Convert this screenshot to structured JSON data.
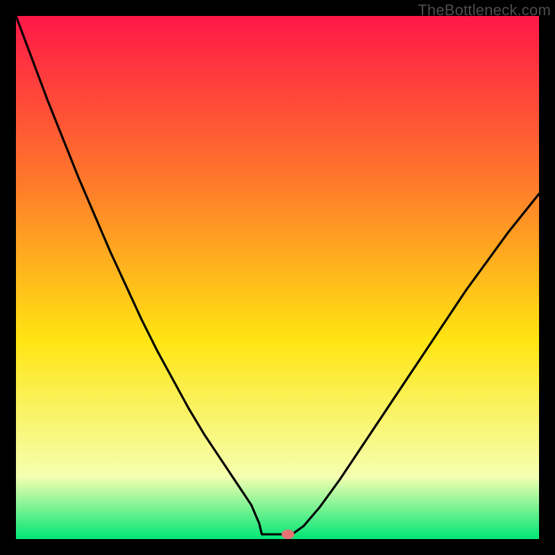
{
  "watermark": "TheBottleneck.com",
  "chart_data": {
    "type": "line",
    "title": "",
    "xlabel": "",
    "ylabel": "",
    "xlim": [
      0,
      100
    ],
    "ylim": [
      0,
      100
    ],
    "grid": false,
    "series": [
      {
        "name": "bottleneck-curve",
        "color": "#000000",
        "x": [
          0.0,
          3.0,
          6.0,
          9.0,
          12.0,
          15.0,
          18.0,
          21.0,
          24.0,
          27.0,
          30.0,
          33.0,
          36.0,
          39.0,
          42.0,
          45.0,
          46.5,
          47.0,
          51.0,
          52.8,
          55.0,
          58.0,
          62.0,
          66.0,
          70.0,
          74.0,
          78.0,
          82.0,
          86.0,
          90.0,
          94.0,
          98.0,
          100.0
        ],
        "y": [
          100.0,
          92.0,
          84.0,
          76.5,
          69.0,
          62.0,
          55.0,
          48.5,
          42.0,
          36.0,
          30.5,
          25.0,
          20.0,
          15.5,
          11.0,
          6.5,
          3.0,
          0.9,
          0.9,
          0.9,
          2.5,
          6.0,
          11.5,
          17.5,
          23.5,
          29.5,
          35.5,
          41.5,
          47.5,
          53.0,
          58.5,
          63.5,
          66.0
        ]
      }
    ],
    "marker": {
      "name": "sweet-spot",
      "x": 52.0,
      "y": 0.9,
      "color": "#e57373"
    },
    "background_gradient": {
      "top": "#ff1848",
      "upper": "#ff7a2a",
      "mid": "#ffe512",
      "lower": "#f6ffb0",
      "bottom": "#00e676"
    }
  }
}
